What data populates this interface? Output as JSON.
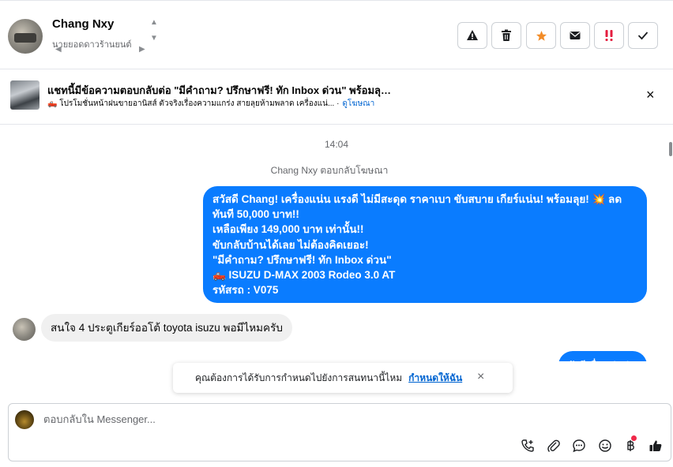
{
  "header": {
    "contact_name": "Chang Nxy",
    "contact_sub": "นายยอดดาวร้านยนต์",
    "actions": [
      {
        "name": "report-button",
        "icon": "warning-icon",
        "label": "⚠"
      },
      {
        "name": "delete-button",
        "icon": "trash-icon",
        "label": "🗑"
      },
      {
        "name": "star-button",
        "icon": "star-icon",
        "label": "★"
      },
      {
        "name": "mark-unread-button",
        "icon": "envelope-icon",
        "label": "✉"
      },
      {
        "name": "important-button",
        "icon": "exclamation-icon",
        "label": "‼"
      },
      {
        "name": "done-button",
        "icon": "check-icon",
        "label": "✓"
      }
    ]
  },
  "ad": {
    "title": "แชทนี้มีข้อความตอบกลับต่อ \"มีคำถาม? ปรึกษาฟรี! ทัก Inbox ด่วน\" พร้อมลุย ...",
    "desc": "🛻 โปรโมชั่นหน้าฝนขายอานิสส์ ตัวจริงเรื่องความแกร่ง สายลุยห้ามพลาด เครื่องแน่... ·",
    "link": "ดูโฆษณา",
    "close_icon": "×"
  },
  "chat": {
    "timestamp": "14:04",
    "replied_note": "Chang Nxy ตอบกลับโฆษณา",
    "outgoing_lines": [
      "สวัสดี Chang! เครื่องแน่น แรงดี ไม่มีสะดุด ราคาเบา ขับสบาย เกียร์แน่น! พร้อมลุย! 💥 ลด",
      "ทันที 50,000 บาท!!",
      "เหลือเพียง 149,000 บาท เท่านั้น!!",
      "ขับกลับบ้านได้เลย ไม่ต้องคิดเยอะ!",
      "\"มีคำถาม? ปรึกษาฟรี! ทัก Inbox ด่วน\"",
      "🛻  ISUZU D-MAX 2003 Rodeo 3.0 AT",
      "รหัสรถ : V075"
    ],
    "incoming": "สนใจ 4 ประตูเกียร์ออโต้ toyota isuzu พอมีไหมครับ",
    "partial_outgoing": "ยังมีเชื่อมต่อค่ะ"
  },
  "toast": {
    "text": "คุณต้องการได้รับการกำหนดไปยังการสนทนานี้ไหม",
    "link": "กำหนดให้ฉัน",
    "close_icon": "×"
  },
  "composer": {
    "placeholder": "ตอบกลับใน Messenger...",
    "tools": [
      "phone-plus-icon",
      "paperclip-icon",
      "chat-bubble-icon",
      "smiley-icon",
      "baht-icon",
      "thumbs-up-icon"
    ]
  },
  "colors": {
    "accent": "#0a7cff",
    "link": "#0064d1",
    "star": "#f28c28",
    "important": "#e41e3f",
    "notification_dot": "#f02849"
  }
}
